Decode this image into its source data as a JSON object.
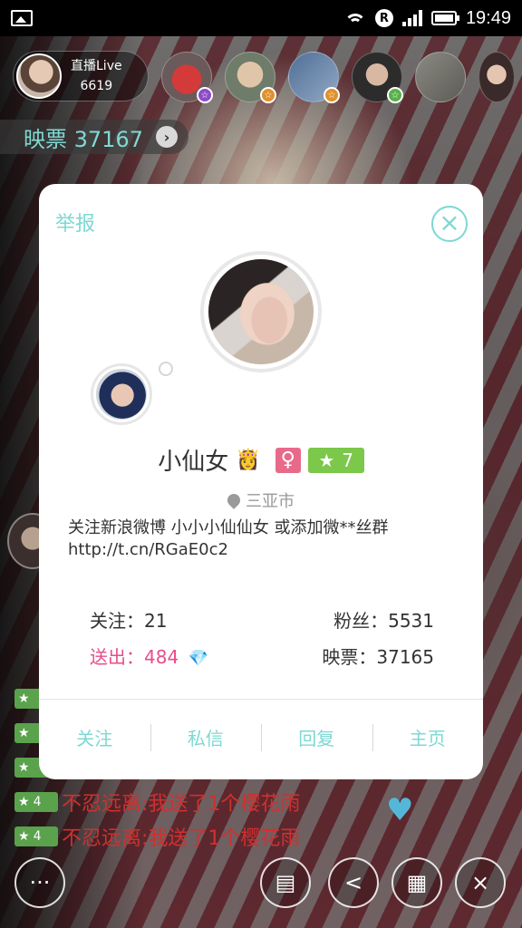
{
  "status_bar": {
    "time": "19:49",
    "r_badge": "R"
  },
  "host": {
    "label": "直播Live",
    "count": "6619"
  },
  "viewers": [
    {
      "badge": "☆",
      "badge_color": "#8d4ac9"
    },
    {
      "badge": "☆",
      "badge_color": "#e0902c"
    },
    {
      "badge": "☆",
      "badge_color": "#e0902c"
    },
    {
      "badge": "☆",
      "badge_color": "#59b04a"
    }
  ],
  "ticket": {
    "label": "映票 37167",
    "arrow": "›"
  },
  "chat": [
    {
      "level": "4",
      "text": "不忍远离:我送了1个樱花雨"
    },
    {
      "level": "4",
      "text": "不忍远离:我送了1个樱花雨"
    }
  ],
  "profile": {
    "report": "举报",
    "close": "×",
    "name": "小仙女",
    "crown": "👸",
    "gender": "♀",
    "level": "7",
    "level_star": "★",
    "location": "三亚市",
    "bio": "关注新浪微博 小小小仙仙女 或添加微**丝群 http://t.cn/RGaE0c2",
    "stats": {
      "following": "关注：21",
      "fans": "粉丝：5531",
      "sent": "送出：484",
      "diamond": "💎",
      "tickets": "映票：37165"
    },
    "actions": {
      "follow": "关注",
      "message": "私信",
      "reply": "回复",
      "homepage": "主页"
    }
  },
  "bottom": {
    "chat": "···",
    "danmu": "▤",
    "share": "<",
    "gift": "▦",
    "close": "×",
    "heart": "♥"
  },
  "colors": {
    "accent": "#7ed8d2",
    "sent": "#e84d8a",
    "level": "#7bc84b",
    "gender": "#e86a8a"
  }
}
